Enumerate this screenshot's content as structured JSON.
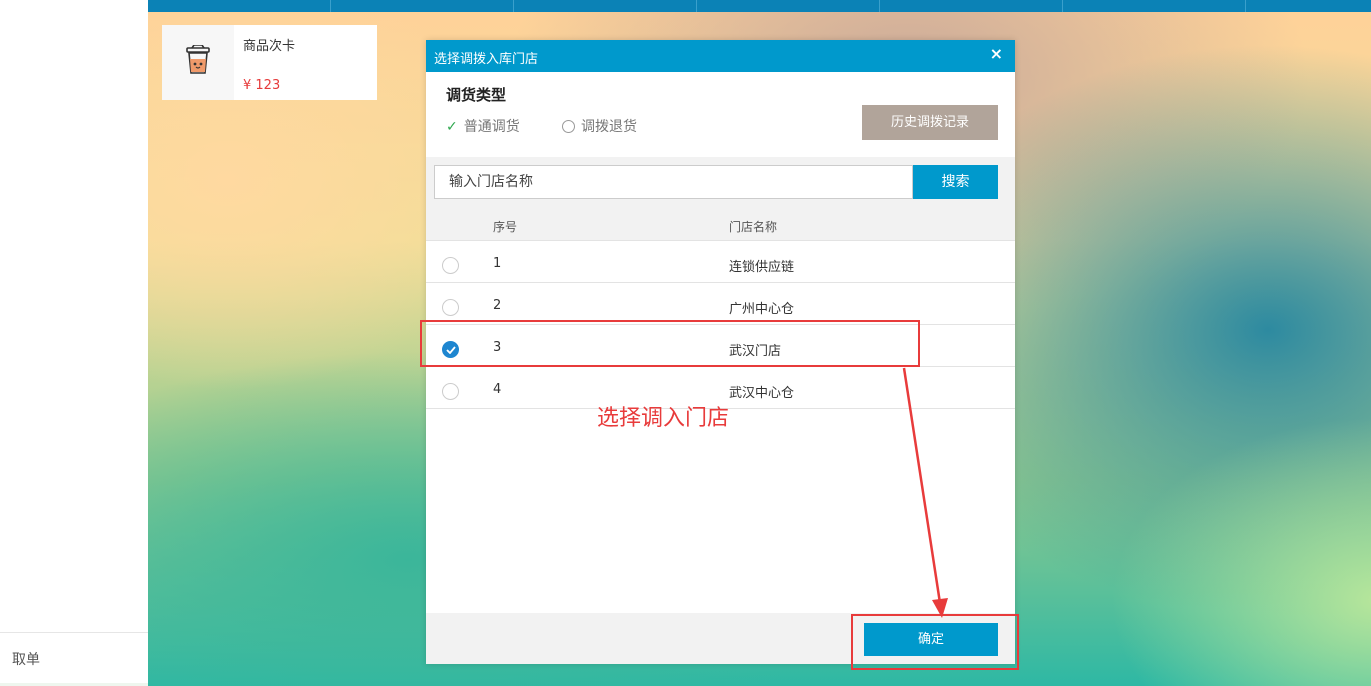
{
  "sidebar": {
    "bottom_item": "取单"
  },
  "product_card": {
    "name": "商品次卡",
    "price": "¥ 123",
    "icon": "cup-icon"
  },
  "dialog": {
    "title": "选择调拨入库门店",
    "close": "×",
    "transfer_type": {
      "label": "调货类型",
      "options": [
        {
          "label": "普通调货",
          "selected": true
        },
        {
          "label": "调拨退货",
          "selected": false
        }
      ]
    },
    "history_button": "历史调拨记录",
    "search": {
      "placeholder": "输入门店名称",
      "button": "搜索"
    },
    "table": {
      "columns": [
        "序号",
        "门店名称"
      ],
      "rows": [
        {
          "no": "1",
          "name": "连锁供应链",
          "selected": false
        },
        {
          "no": "2",
          "name": "广州中心仓",
          "selected": false
        },
        {
          "no": "3",
          "name": "武汉门店",
          "selected": true
        },
        {
          "no": "4",
          "name": "武汉中心仓",
          "selected": false
        }
      ]
    },
    "confirm_button": "确定"
  },
  "annotation": {
    "text": "选择调入门店",
    "color": "#e83b3b"
  },
  "colors": {
    "accent": "#0099cc",
    "history_button": "#b1a49a",
    "price": "#e63b3b"
  }
}
